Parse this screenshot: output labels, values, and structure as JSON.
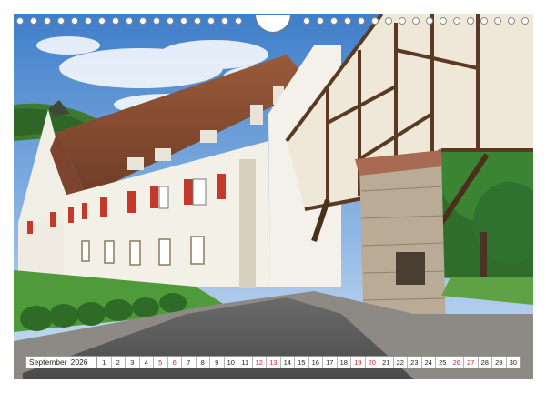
{
  "photo": {
    "subject": "half-timbered monastery courtyard with arcaded gatehouse"
  },
  "calendar": {
    "month": "September",
    "year": "2026",
    "days": [
      "1",
      "2",
      "3",
      "4",
      "5",
      "6",
      "7",
      "8",
      "9",
      "10",
      "11",
      "12",
      "13",
      "14",
      "15",
      "16",
      "17",
      "18",
      "19",
      "20",
      "21",
      "22",
      "23",
      "24",
      "25",
      "26",
      "27",
      "28",
      "29",
      "30"
    ],
    "weekend_days": [
      "5",
      "6",
      "12",
      "13",
      "19",
      "20",
      "26",
      "27"
    ],
    "colors": {
      "weekend": "#d0262a",
      "weekday": "#222222"
    }
  },
  "binding": {
    "icon": "spiral-ring-icon",
    "hanger_icon": "hanger-hook-icon"
  }
}
